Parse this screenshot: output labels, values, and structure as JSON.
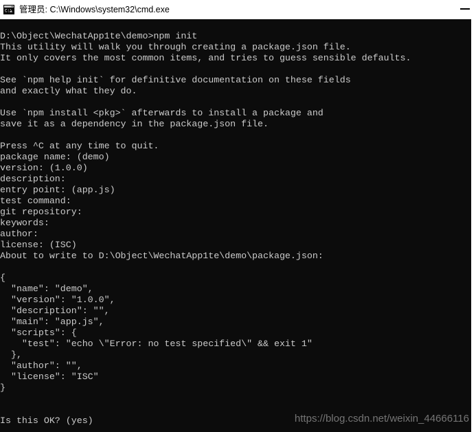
{
  "window": {
    "title": "管理员: C:\\Windows\\system32\\cmd.exe",
    "icon": "cmd-console-icon",
    "controls": {
      "minimize_label": "—"
    },
    "colors": {
      "titlebar_bg": "#ffffff",
      "console_bg": "#0c0c0c",
      "console_fg": "#cccccc",
      "watermark_fg": "#757575"
    }
  },
  "terminal": {
    "prompt_path": "D:\\Object\\WechatApp1te\\demo",
    "command": "npm init",
    "lines": [
      "D:\\Object\\WechatApp1te\\demo>npm init",
      "This utility will walk you through creating a package.json file.",
      "It only covers the most common items, and tries to guess sensible defaults.",
      "",
      "See `npm help init` for definitive documentation on these fields",
      "and exactly what they do.",
      "",
      "Use `npm install <pkg>` afterwards to install a package and",
      "save it as a dependency in the package.json file.",
      "",
      "Press ^C at any time to quit.",
      "package name: (demo)",
      "version: (1.0.0)",
      "description:",
      "entry point: (app.js)",
      "test command:",
      "git repository:",
      "keywords:",
      "author:",
      "license: (ISC)",
      "About to write to D:\\Object\\WechatApp1te\\demo\\package.json:",
      "",
      "{",
      "  \"name\": \"demo\",",
      "  \"version\": \"1.0.0\",",
      "  \"description\": \"\",",
      "  \"main\": \"app.js\",",
      "  \"scripts\": {",
      "    \"test\": \"echo \\\"Error: no test specified\\\" && exit 1\"",
      "  },",
      "  \"author\": \"\",",
      "  \"license\": \"ISC\"",
      "}",
      "",
      "",
      "Is this OK? (yes)"
    ]
  },
  "watermark": {
    "text": "https://blog.csdn.net/weixin_44666116"
  }
}
